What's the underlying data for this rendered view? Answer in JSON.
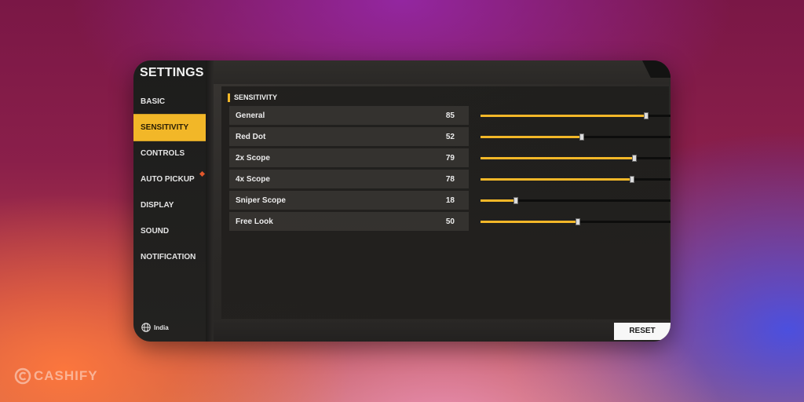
{
  "window": {
    "title": "SETTINGS",
    "reset_label": "RESET"
  },
  "sidebar": {
    "items": [
      {
        "label": "BASIC",
        "active": false
      },
      {
        "label": "SENSITIVITY",
        "active": true
      },
      {
        "label": "CONTROLS",
        "active": false
      },
      {
        "label": "AUTO PICKUP",
        "active": false
      },
      {
        "label": "DISPLAY",
        "active": false
      },
      {
        "label": "SOUND",
        "active": false
      },
      {
        "label": "NOTIFICATION",
        "active": false
      }
    ],
    "region": {
      "label": "India",
      "icon": "globe-icon"
    }
  },
  "main": {
    "section_title": "SENSITIVITY",
    "rows": [
      {
        "label": "General",
        "value": "85",
        "level": 85
      },
      {
        "label": "Red Dot",
        "value": "52",
        "level": 52
      },
      {
        "label": "2x Scope",
        "value": "79",
        "level": 79
      },
      {
        "label": "4x Scope",
        "value": "78",
        "level": 78
      },
      {
        "label": "Sniper Scope",
        "value": "18",
        "level": 18
      },
      {
        "label": "Free Look",
        "value": "50",
        "level": 50
      }
    ]
  },
  "watermark": {
    "text": "CASHIFY"
  },
  "colors": {
    "accent": "#f2b728",
    "panel": "#2b2927",
    "sidebar": "#1d1d1c",
    "track": "#0d0d0c",
    "reset_bg": "#f7f7f7"
  }
}
